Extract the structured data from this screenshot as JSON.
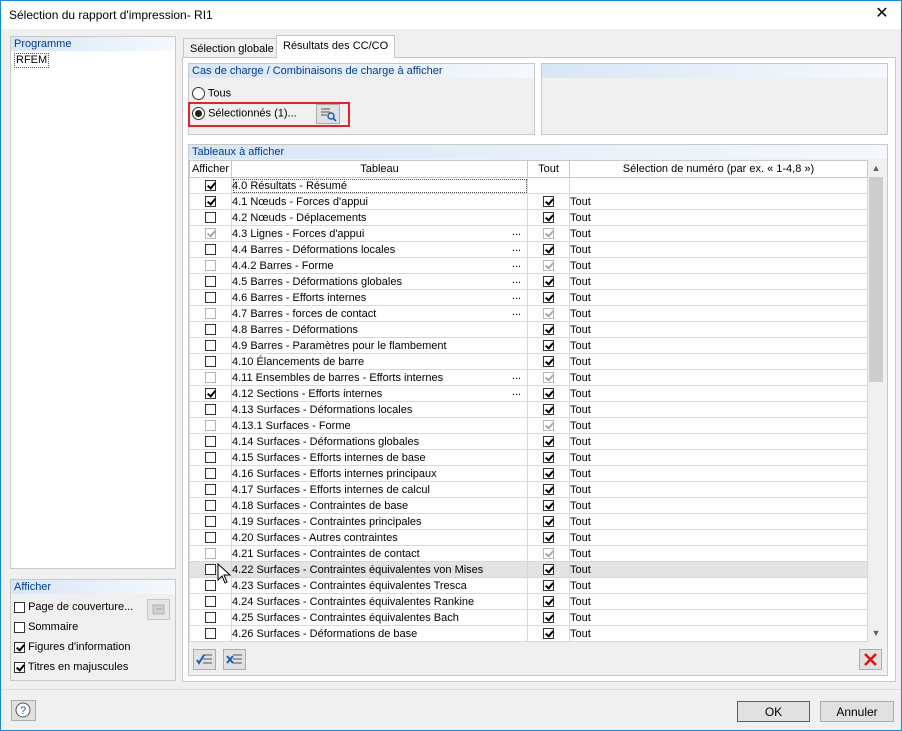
{
  "window": {
    "title": "Sélection du rapport d'impression- RI1",
    "close_glyph": "✕"
  },
  "programme": {
    "header": "Programme",
    "items": [
      "RFEM"
    ]
  },
  "afficher": {
    "header": "Afficher",
    "options": [
      {
        "label": "Page de couverture...",
        "checked": false
      },
      {
        "label": "Sommaire",
        "checked": false
      },
      {
        "label": "Figures d'information",
        "checked": true
      },
      {
        "label": "Titres en majuscules",
        "checked": true
      }
    ]
  },
  "tabs": [
    {
      "label": "Sélection globale"
    },
    {
      "label": "Résultats des CC/CO"
    }
  ],
  "cases": {
    "header": "Cas de charge / Combinaisons de charge à afficher",
    "radio_all": "Tous",
    "radio_selected": "Sélectionnés (1)..."
  },
  "tables": {
    "header": "Tableaux à afficher",
    "columns": [
      "Afficher",
      "Tableau",
      "Tout",
      "Sélection de numéro (par ex. « 1-4,8 »)"
    ],
    "rows": [
      {
        "show": true,
        "show_dis": false,
        "name": "4.0 Résultats - Résumé",
        "dots": "",
        "all": null,
        "all_dis": false,
        "sel": ""
      },
      {
        "show": true,
        "show_dis": false,
        "name": "4.1 Nœuds - Forces d'appui",
        "dots": "",
        "all": true,
        "all_dis": false,
        "sel": "Tout"
      },
      {
        "show": false,
        "show_dis": false,
        "name": "4.2 Nœuds - Déplacements",
        "dots": "",
        "all": true,
        "all_dis": false,
        "sel": "Tout"
      },
      {
        "show": true,
        "show_dis": true,
        "name": "4.3 Lignes - Forces d'appui",
        "dots": "...",
        "all": true,
        "all_dis": true,
        "sel": "Tout"
      },
      {
        "show": false,
        "show_dis": false,
        "name": "4.4 Barres - Déformations locales",
        "dots": "...",
        "all": true,
        "all_dis": false,
        "sel": "Tout"
      },
      {
        "show": false,
        "show_dis": true,
        "name": "4.4.2 Barres - Forme",
        "dots": "...",
        "all": true,
        "all_dis": true,
        "sel": "Tout"
      },
      {
        "show": false,
        "show_dis": false,
        "name": "4.5 Barres - Déformations globales",
        "dots": "...",
        "all": true,
        "all_dis": false,
        "sel": "Tout"
      },
      {
        "show": false,
        "show_dis": false,
        "name": "4.6 Barres - Efforts internes",
        "dots": "...",
        "all": true,
        "all_dis": false,
        "sel": "Tout"
      },
      {
        "show": false,
        "show_dis": true,
        "name": "4.7 Barres - forces de contact",
        "dots": "...",
        "all": true,
        "all_dis": true,
        "sel": "Tout"
      },
      {
        "show": false,
        "show_dis": false,
        "name": "4.8 Barres - Déformations",
        "dots": "",
        "all": true,
        "all_dis": false,
        "sel": "Tout"
      },
      {
        "show": false,
        "show_dis": false,
        "name": "4.9 Barres - Paramètres pour le flambement",
        "dots": "",
        "all": true,
        "all_dis": false,
        "sel": "Tout"
      },
      {
        "show": false,
        "show_dis": false,
        "name": "4.10 Élancements de barre",
        "dots": "",
        "all": true,
        "all_dis": false,
        "sel": "Tout"
      },
      {
        "show": false,
        "show_dis": true,
        "name": "4.11 Ensembles de barres - Efforts internes",
        "dots": "...",
        "all": true,
        "all_dis": true,
        "sel": "Tout"
      },
      {
        "show": true,
        "show_dis": false,
        "name": "4.12 Sections - Efforts internes",
        "dots": "...",
        "all": true,
        "all_dis": false,
        "sel": "Tout"
      },
      {
        "show": false,
        "show_dis": false,
        "name": "4.13 Surfaces - Déformations locales",
        "dots": "",
        "all": true,
        "all_dis": false,
        "sel": "Tout"
      },
      {
        "show": false,
        "show_dis": true,
        "name": "4.13.1 Surfaces - Forme",
        "dots": "",
        "all": true,
        "all_dis": true,
        "sel": "Tout"
      },
      {
        "show": false,
        "show_dis": false,
        "name": "4.14 Surfaces - Déformations globales",
        "dots": "",
        "all": true,
        "all_dis": false,
        "sel": "Tout"
      },
      {
        "show": false,
        "show_dis": false,
        "name": "4.15 Surfaces - Efforts internes de base",
        "dots": "",
        "all": true,
        "all_dis": false,
        "sel": "Tout"
      },
      {
        "show": false,
        "show_dis": false,
        "name": "4.16 Surfaces - Efforts internes principaux",
        "dots": "",
        "all": true,
        "all_dis": false,
        "sel": "Tout"
      },
      {
        "show": false,
        "show_dis": false,
        "name": "4.17 Surfaces - Efforts internes de calcul",
        "dots": "",
        "all": true,
        "all_dis": false,
        "sel": "Tout"
      },
      {
        "show": false,
        "show_dis": false,
        "name": "4.18 Surfaces - Contraintes de base",
        "dots": "",
        "all": true,
        "all_dis": false,
        "sel": "Tout"
      },
      {
        "show": false,
        "show_dis": false,
        "name": "4.19 Surfaces - Contraintes principales",
        "dots": "",
        "all": true,
        "all_dis": false,
        "sel": "Tout"
      },
      {
        "show": false,
        "show_dis": false,
        "name": "4.20 Surfaces - Autres contraintes",
        "dots": "",
        "all": true,
        "all_dis": false,
        "sel": "Tout"
      },
      {
        "show": false,
        "show_dis": true,
        "name": "4.21 Surfaces - Contraintes de contact",
        "dots": "",
        "all": true,
        "all_dis": true,
        "sel": "Tout"
      },
      {
        "show": false,
        "show_dis": false,
        "name": "4.22 Surfaces - Contraintes équivalentes von Mises",
        "dots": "",
        "all": true,
        "all_dis": false,
        "sel": "Tout"
      },
      {
        "show": false,
        "show_dis": false,
        "name": "4.23 Surfaces - Contraintes équivalentes Tresca",
        "dots": "",
        "all": true,
        "all_dis": false,
        "sel": "Tout"
      },
      {
        "show": false,
        "show_dis": false,
        "name": "4.24 Surfaces - Contraintes équivalentes Rankine",
        "dots": "",
        "all": true,
        "all_dis": false,
        "sel": "Tout"
      },
      {
        "show": false,
        "show_dis": false,
        "name": "4.25 Surfaces - Contraintes équivalentes Bach",
        "dots": "",
        "all": true,
        "all_dis": false,
        "sel": "Tout"
      },
      {
        "show": false,
        "show_dis": false,
        "name": "4.26 Surfaces - Déformations de base",
        "dots": "",
        "all": true,
        "all_dis": false,
        "sel": "Tout"
      }
    ]
  },
  "buttons": {
    "ok": "OK",
    "cancel": "Annuler"
  },
  "colors": {
    "accent": "#1a8ad4",
    "highlight_box": "#e0262c",
    "header_text": "#003c8c"
  }
}
